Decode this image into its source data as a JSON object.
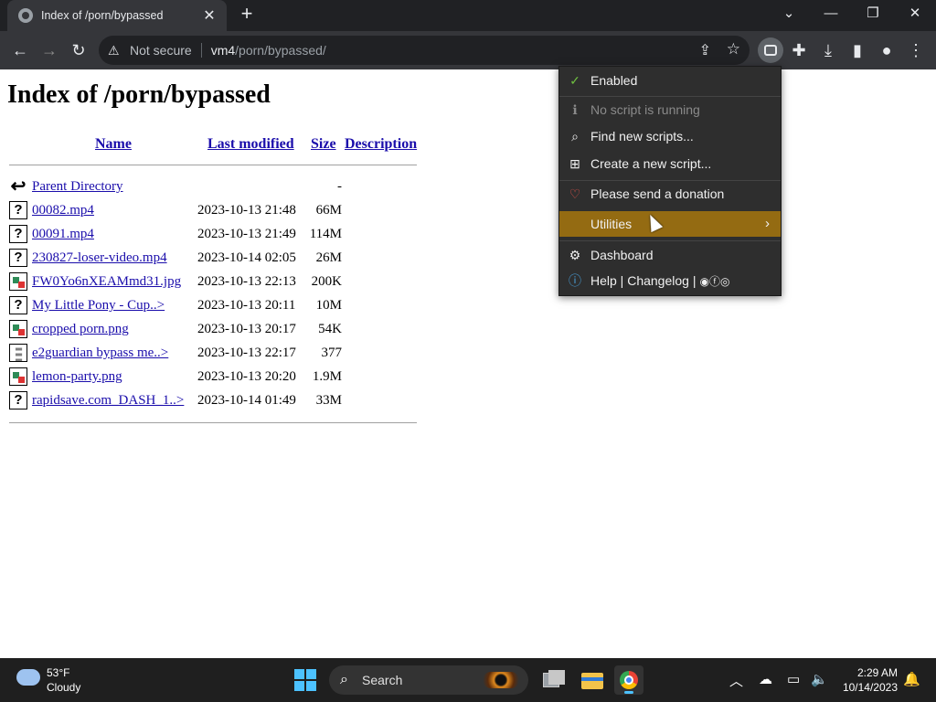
{
  "browser": {
    "tab_title": "Index of /porn/bypassed",
    "tab_close": "✕",
    "new_tab": "+",
    "security_label": "Not secure",
    "url_host": "vm4",
    "url_path": "/porn/bypassed/"
  },
  "page": {
    "heading": "Index of /porn/bypassed",
    "columns": {
      "name": "Name",
      "last_modified": "Last modified",
      "size": "Size",
      "description": "Description"
    },
    "parent": {
      "name": "Parent Directory",
      "size": "-"
    },
    "rows": [
      {
        "name": "00082.mp4",
        "modified": "2023-10-13 21:48",
        "size": "66M",
        "icon": "unknown-file-icon"
      },
      {
        "name": "00091.mp4",
        "modified": "2023-10-13 21:49",
        "size": "114M",
        "icon": "unknown-file-icon"
      },
      {
        "name": "230827-loser-video.mp4",
        "modified": "2023-10-14 02:05",
        "size": "26M",
        "icon": "unknown-file-icon"
      },
      {
        "name": "FW0Yo6nXEAMmd31.jpg",
        "modified": "2023-10-13 22:13",
        "size": "200K",
        "icon": "image-file-icon"
      },
      {
        "name": "My Little Pony - Cup..>",
        "modified": "2023-10-13 20:11",
        "size": "10M",
        "icon": "unknown-file-icon"
      },
      {
        "name": "cropped porn.png",
        "modified": "2023-10-13 20:17",
        "size": "54K",
        "icon": "image-file-icon"
      },
      {
        "name": "e2guardian bypass me..>",
        "modified": "2023-10-13 22:17",
        "size": "377",
        "icon": "text-file-icon"
      },
      {
        "name": "lemon-party.png",
        "modified": "2023-10-13 20:20",
        "size": "1.9M",
        "icon": "image-file-icon"
      },
      {
        "name": "rapidsave.com_DASH_1..>",
        "modified": "2023-10-14 01:49",
        "size": "33M",
        "icon": "unknown-file-icon"
      }
    ]
  },
  "tampermonkey_menu": {
    "enabled": "Enabled",
    "no_script": "No script is running",
    "find_scripts": "Find new scripts...",
    "create_script": "Create a new script...",
    "donation": "Please send a donation",
    "utilities": "Utilities",
    "dashboard": "Dashboard",
    "help": "Help | Changelog |",
    "accent_color": "#946b12"
  },
  "taskbar": {
    "weather_temp": "53°F",
    "weather_desc": "Cloudy",
    "search_label": "Search",
    "time": "2:29 AM",
    "date": "10/14/2023"
  }
}
